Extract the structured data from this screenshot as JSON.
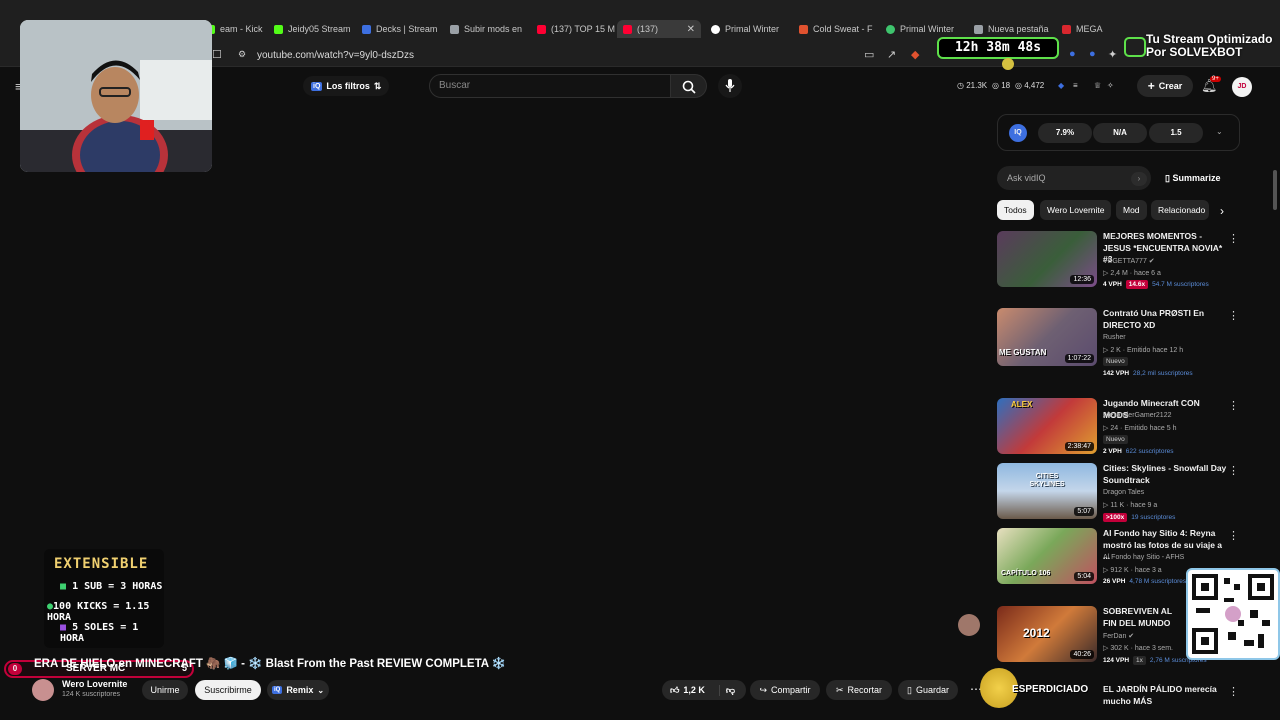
{
  "browser": {
    "tabs": [
      {
        "label": "eam - Kick D",
        "color": "#53fc18"
      },
      {
        "label": "Jeidy05 Stream",
        "color": "#53fc18"
      },
      {
        "label": "Decks | Stream",
        "color": "#3d6fe0"
      },
      {
        "label": "Subir mods en",
        "color": "#9aa0a6"
      },
      {
        "label": "(137) TOP 15 M",
        "color": "#ff0033"
      },
      {
        "label": "(137)",
        "color": "#ff0033"
      },
      {
        "label": "Primal Winter",
        "color": "#ffffff"
      },
      {
        "label": "Cold Sweat - F",
        "color": "#e0522f"
      },
      {
        "label": "Primal Winter",
        "color": "#3ec46d"
      },
      {
        "label": "Nueva pestaña",
        "color": "#9aa0a6"
      },
      {
        "label": "MEGA",
        "color": "#d9272e"
      }
    ],
    "url": "youtube.com/watch?v=9yl0-dszDzs"
  },
  "youtube": {
    "filters_label": "Los filtros",
    "search_placeholder": "Buscar",
    "stats": {
      "views": "21.3K",
      "count_a": "18",
      "count_b": "4,472"
    },
    "create_label": "Crear",
    "notif_badge": "9+",
    "avatar_initials": "JD"
  },
  "stream_overlay": {
    "timer": "12h 38m 48s",
    "optimized_line1": "Tu Stream Optimizado",
    "optimized_line2": "Por SOLVEXBOT",
    "extensible_title": "EXTENSIBLE",
    "extensible_rows": [
      {
        "label": "1 SUB = 3 HORAS"
      },
      {
        "label": "100 KICKS = 1.15 HORA"
      },
      {
        "label": "5 SOLES = 1 HORA"
      }
    ],
    "server_label": "SERVER MC",
    "server_left": "0",
    "server_right": "5",
    "esperdiciado": "ESPERDICIADO"
  },
  "vidiq": {
    "badge": "IQ",
    "metrics": [
      "7.9%",
      "N/A",
      "1.5"
    ],
    "ask_placeholder": "Ask vidIQ",
    "summarize_label": "Summarize",
    "chips": [
      {
        "label": "Todos",
        "selected": true
      },
      {
        "label": "Wero Lovernite",
        "selected": false
      },
      {
        "label": "Mod",
        "selected": false
      },
      {
        "label": "Relacionado",
        "selected": false
      }
    ]
  },
  "recommendations": [
    {
      "title": "MEJORES MOMENTOS - JESUS *ENCUENTRA NOVIA* #3",
      "channel": "VEGETTA777",
      "verified": true,
      "meta": "2,4 M · hace 6 a",
      "vph": "4 VPH",
      "outlier": "14.6x",
      "subs": "54.7 M suscriptores",
      "nuevo": false,
      "duration": "12:36"
    },
    {
      "title": "Contrató Una PRØSTI En DIRECTO XD",
      "channel": "Rusher",
      "verified": false,
      "meta": "2 K · Emitido hace 12 h",
      "vph": "142 VPH",
      "outlier": "",
      "subs": "28,2 mil suscriptores",
      "nuevo": true,
      "duration": "1:07:22",
      "thumb_text": "ME GUSTAN"
    },
    {
      "title": "Jugando Minecraft CON MODS",
      "channel": "AlexanderGamer2122",
      "verified": false,
      "meta": "24 · Emitido hace 5 h",
      "vph": "2 VPH",
      "outlier": "",
      "subs": "622 suscriptores",
      "nuevo": true,
      "duration": "2:38:47",
      "thumb_text": "ALEX"
    },
    {
      "title": "Cities: Skylines - Snowfall Day Soundtrack",
      "channel": "Dragon Tales",
      "verified": false,
      "meta": "11 K · hace 9 a",
      "vph": "",
      "outlier": ">100x",
      "subs": "19 suscriptores",
      "nuevo": false,
      "duration": "5:07",
      "thumb_text": "CITIES SKYLINES"
    },
    {
      "title": "Al Fondo hay Sitio 4: Reyna mostró las fotos de su viaje a ...",
      "channel": "Al Fondo hay Sitio - AFHS",
      "verified": false,
      "meta": "912 K · hace 3 a",
      "vph": "26 VPH",
      "outlier": "",
      "subs": "4,78 M suscriptores",
      "nuevo": false,
      "duration": "5:04",
      "thumb_text": "CAPÍTULO 106"
    },
    {
      "title": "SOBREVIVEN AL FIN DEL MUNDO",
      "channel": "FerDan",
      "verified": true,
      "meta": "302 K · hace 3 sem.",
      "vph": "124 VPH",
      "outlier": "1x",
      "subs": "2,76 M suscriptores",
      "nuevo": false,
      "duration": "40:26",
      "thumb_text": "2012"
    },
    {
      "title": "EL JARDÍN PÁLIDO merecía mucho MÁS",
      "channel": "",
      "verified": false,
      "meta": "",
      "vph": "",
      "outlier": "",
      "subs": "",
      "nuevo": false,
      "duration": ""
    }
  ],
  "video": {
    "title": "ERA DE HIELO en MINECRAFT 🦣 🧊 - ❄️ Blast From the Past REVIEW COMPLETA ❄️",
    "channel": "Wero Lovernite",
    "subs": "124 K suscriptores",
    "join_label": "Unirme",
    "subscribe_label": "Suscribirme",
    "remix_label": "Remix",
    "likes": "1,2 K",
    "share_label": "Compartir",
    "clip_label": "Recortar",
    "save_label": "Guardar"
  }
}
